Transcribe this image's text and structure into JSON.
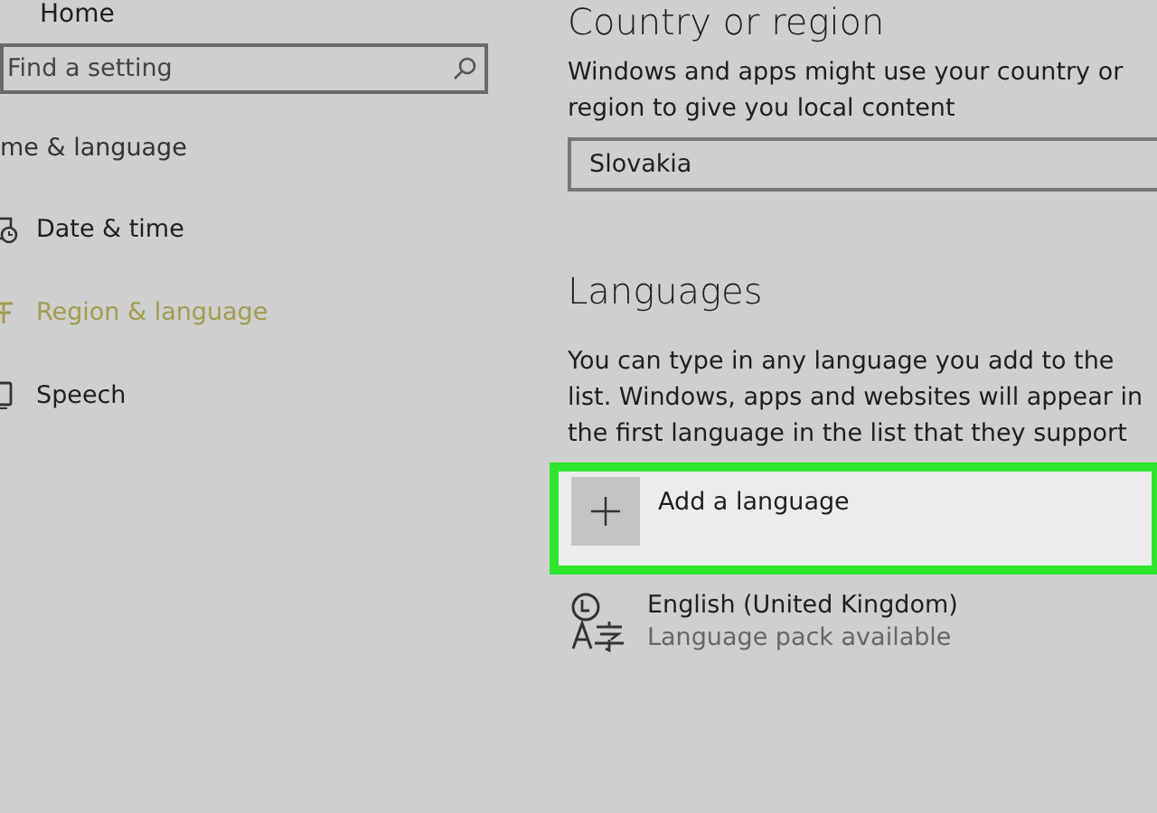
{
  "sidebar": {
    "home": "Home",
    "search": {
      "placeholder": "Find a setting"
    },
    "section": "me & language",
    "items": [
      {
        "label": "Date & time",
        "selected": false
      },
      {
        "label": "Region & language",
        "selected": true
      },
      {
        "label": "Speech",
        "selected": false
      }
    ]
  },
  "main": {
    "region_heading": "Country or region",
    "region_text": "Windows and apps might use your country or region to give you local content",
    "region_value": "Slovakia",
    "languages_heading": "Languages",
    "languages_text": "You can type in any language you add to the list. Windows, apps and websites will appear in the first language in the list that they support",
    "add_button": {
      "label": "Add a language",
      "highlighted": true
    },
    "languages": [
      {
        "name": "English (United Kingdom)",
        "status": "Language pack available"
      }
    ]
  }
}
